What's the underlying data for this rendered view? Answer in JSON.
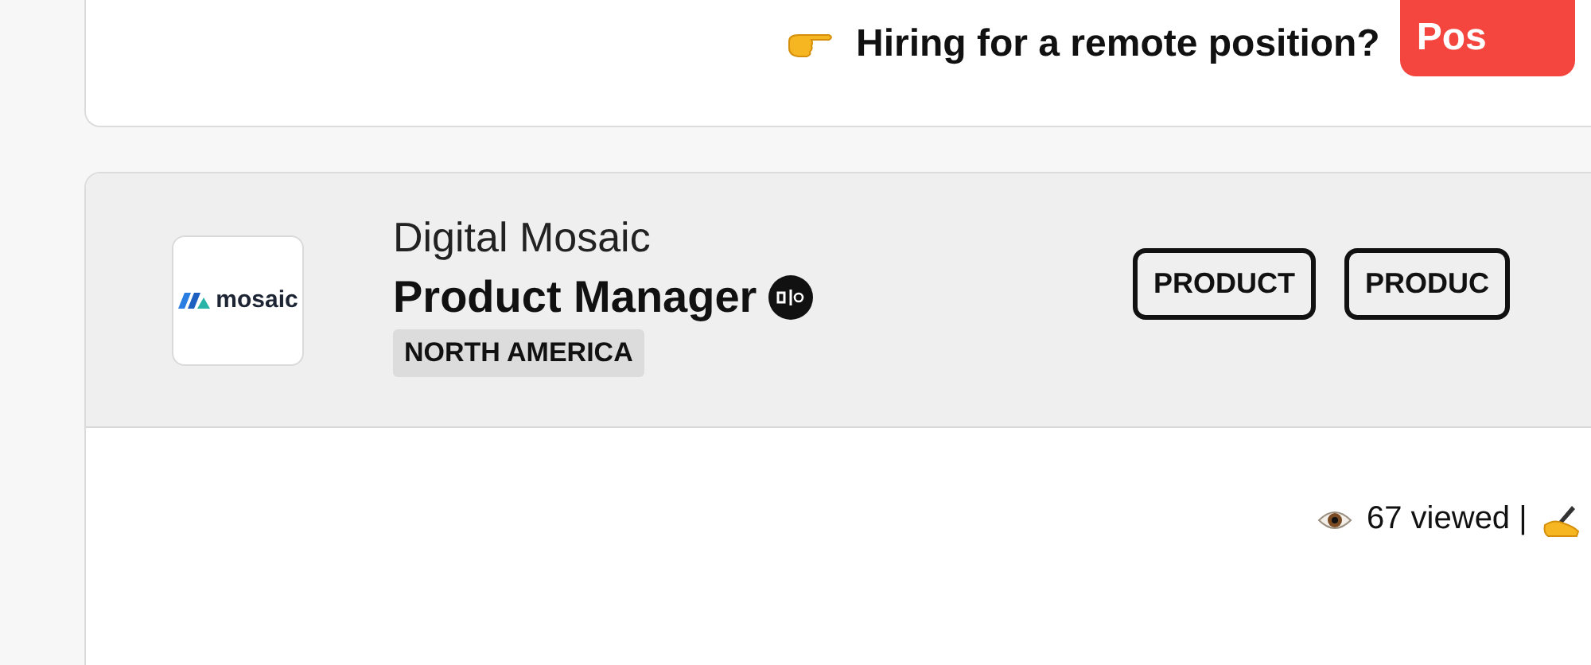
{
  "hiring_banner": {
    "text": "Hiring for a remote position?",
    "button": "Pos"
  },
  "job": {
    "logo_text": "mosaic",
    "company": "Digital Mosaic",
    "title": "Product Manager",
    "region": "NORTH AMERICA",
    "tags": [
      "PRODUCT",
      "PRODUC"
    ],
    "views": "67 viewed |"
  }
}
